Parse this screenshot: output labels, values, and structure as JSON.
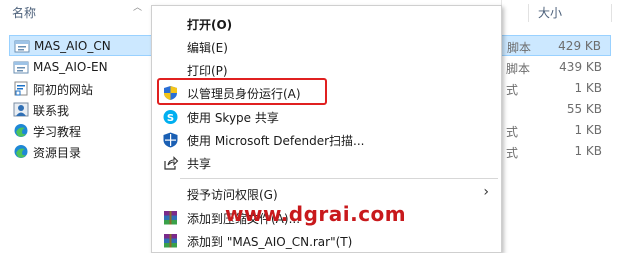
{
  "explorer": {
    "col_name": "名称",
    "col_size": "大小",
    "files": [
      {
        "name": "MAS_AIO_CN",
        "type": "脚本",
        "size": "429 KB",
        "icon": "script-file-icon",
        "selected": true
      },
      {
        "name": "MAS_AIO-EN",
        "type": "脚本",
        "size": "439 KB",
        "icon": "script-file-icon",
        "selected": false
      },
      {
        "name": "阿初的网站",
        "type": "式",
        "size": "1 KB",
        "icon": "shortcut-icon",
        "selected": false
      },
      {
        "name": "联系我",
        "type": "",
        "size": "55 KB",
        "icon": "contact-image-icon",
        "selected": false
      },
      {
        "name": "学习教程",
        "type": "式",
        "size": "1 KB",
        "icon": "edge-browser-icon",
        "selected": false
      },
      {
        "name": "资源目录",
        "type": "式",
        "size": "1 KB",
        "icon": "edge-browser-icon",
        "selected": false
      }
    ]
  },
  "context_menu": {
    "items": [
      {
        "label": "打开(O)",
        "bold": true,
        "icon": ""
      },
      {
        "label": "编辑(E)",
        "bold": false,
        "icon": ""
      },
      {
        "label": "打印(P)",
        "bold": false,
        "icon": ""
      },
      {
        "label": "以管理员身份运行(A)",
        "bold": false,
        "icon": "uac-shield-icon"
      },
      {
        "label": "使用 Skype 共享",
        "bold": false,
        "icon": "skype-icon"
      },
      {
        "label": "使用 Microsoft Defender扫描...",
        "bold": false,
        "icon": "defender-shield-icon"
      },
      {
        "label": "共享",
        "bold": false,
        "icon": "share-icon"
      },
      {
        "label": "授予访问权限(G)",
        "bold": false,
        "icon": ""
      },
      {
        "label": "添加到压缩文件(A)...",
        "bold": false,
        "icon": "winrar-icon"
      },
      {
        "label": "添加到 \"MAS_AIO_CN.rar\"(T)",
        "bold": false,
        "icon": "winrar-icon"
      }
    ],
    "submenu_arrow": "›"
  },
  "watermark": "www.dgrai.com",
  "colors": {
    "selection_bg": "#cce8ff",
    "highlight_border": "#e02020",
    "watermark": "#c8191c"
  }
}
